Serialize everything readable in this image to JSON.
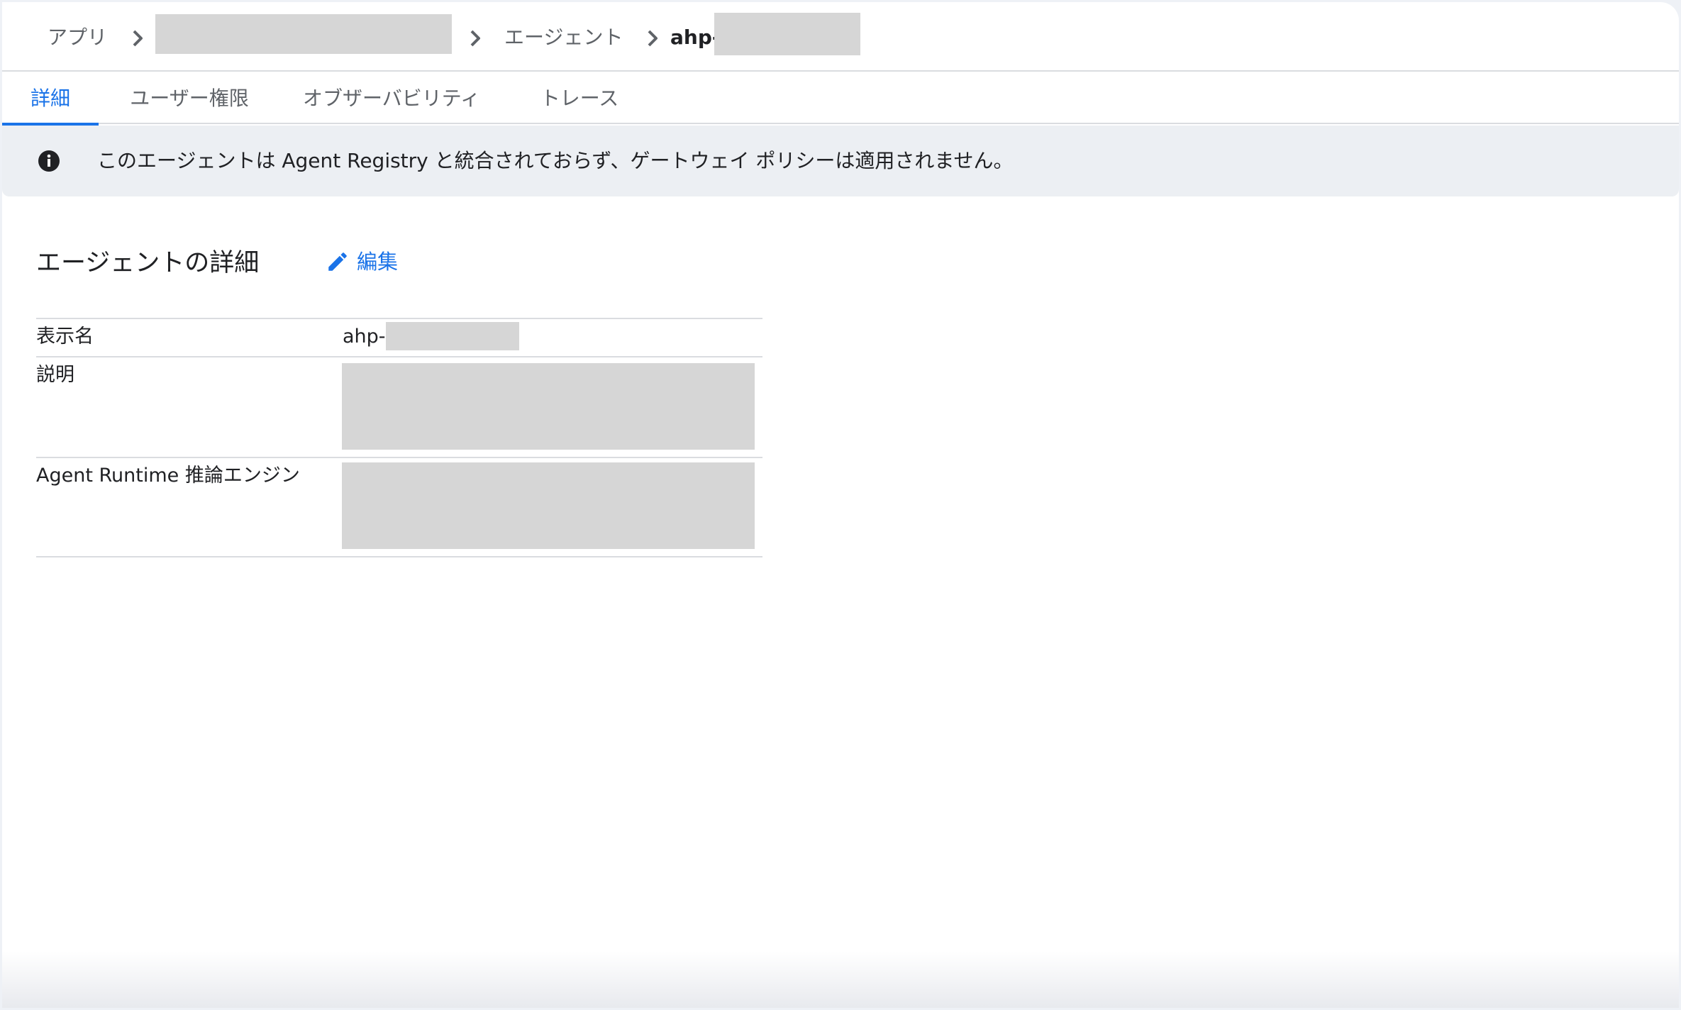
{
  "breadcrumb": {
    "app_label": "アプリ",
    "agents_label": "エージェント",
    "current_prefix": "ahp-"
  },
  "tabs": [
    {
      "label": "詳細",
      "active": true
    },
    {
      "label": "ユーザー権限",
      "active": false
    },
    {
      "label": "オブザーバビリティ",
      "active": false
    },
    {
      "label": "トレース",
      "active": false
    }
  ],
  "banner": {
    "icon": "info-icon",
    "message": "このエージェントは Agent Registry と統合されておらず、ゲートウェイ ポリシーは適用されません。"
  },
  "section": {
    "title": "エージェントの詳細",
    "edit_label": "編集",
    "edit_icon": "pencil-icon"
  },
  "details": [
    {
      "label": "表示名",
      "value_prefix": "ahp-"
    },
    {
      "label": "説明"
    },
    {
      "label": "Agent Runtime 推論エンジン"
    }
  ],
  "colors": {
    "accent": "#1a73e8",
    "banner_bg": "#eceff3",
    "redaction": "#d6d6d6",
    "divider": "#dadce0"
  }
}
